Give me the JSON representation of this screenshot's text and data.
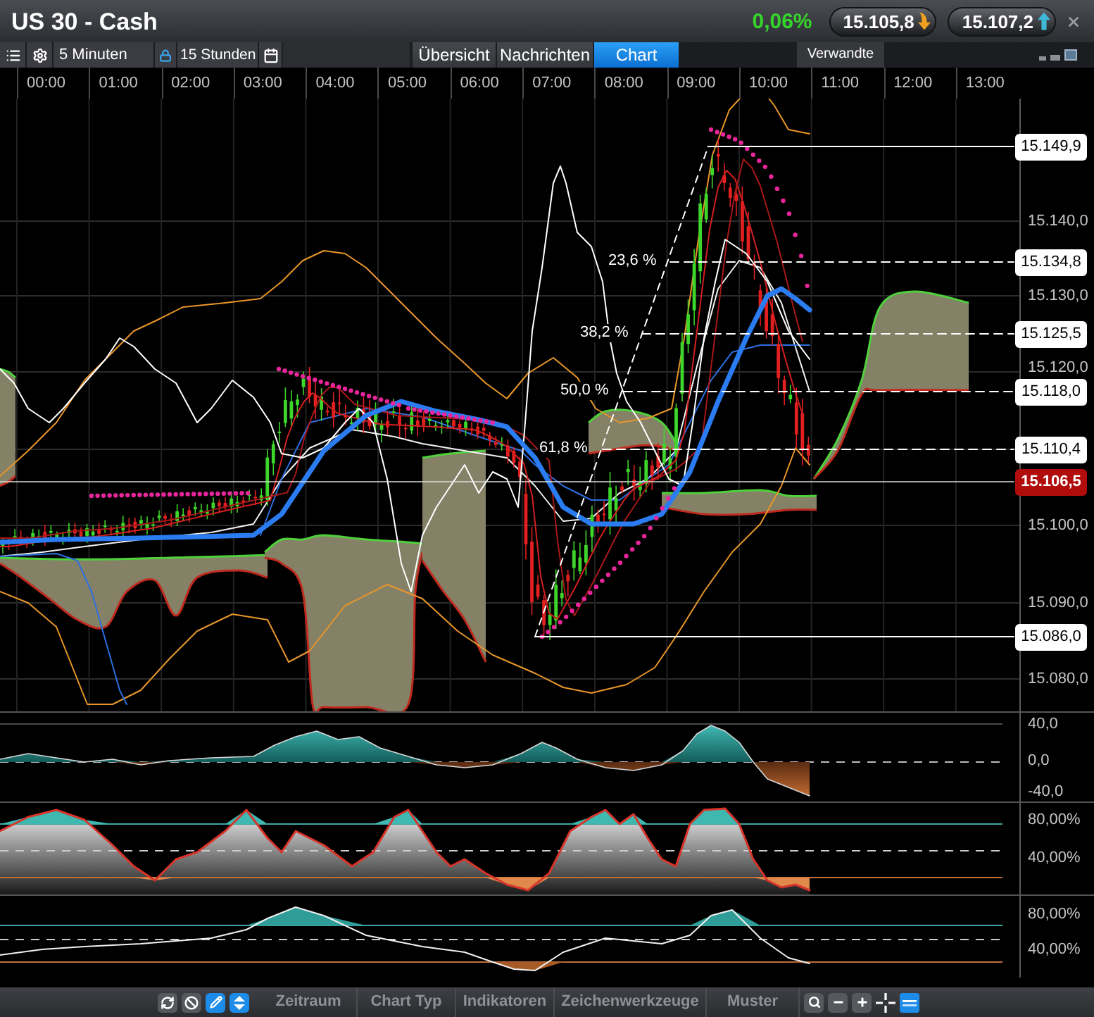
{
  "window": {
    "title": "US 30 - Cash",
    "change": "0,06%",
    "quotes": [
      {
        "value": "15.105,8",
        "up": false
      },
      {
        "value": "15.107,2",
        "up": true
      }
    ]
  },
  "toolbar": {
    "interval": "5 Minuten",
    "range": "15 Stunden"
  },
  "tabs": [
    {
      "label": "Übersicht",
      "selected": false
    },
    {
      "label": "Nachrichten",
      "selected": false
    },
    {
      "label": "Chart",
      "selected": true
    }
  ],
  "related_tab": "Verwandte",
  "time_axis": [
    "00:00",
    "01:00",
    "02:00",
    "03:00",
    "04:00",
    "05:00",
    "06:00",
    "07:00",
    "08:00",
    "09:00",
    "10:00",
    "11:00",
    "12:00",
    "13:00"
  ],
  "price_axis": [
    "15.140,0",
    "15.130,0",
    "15.120,0",
    "15.100,0",
    "15.090,0",
    "15.080,0"
  ],
  "price_markers": [
    {
      "label": "15.149,9",
      "kind": "level"
    },
    {
      "label": "15.134,8",
      "kind": "level"
    },
    {
      "label": "15.125,5",
      "kind": "level"
    },
    {
      "label": "15.118,0",
      "kind": "level"
    },
    {
      "label": "15.110,4",
      "kind": "level"
    },
    {
      "label": "15.106,5",
      "kind": "current"
    },
    {
      "label": "15.086,0",
      "kind": "level"
    }
  ],
  "fib_levels": [
    "23,6 %",
    "38,2 %",
    "50,0 %",
    "61,8 %"
  ],
  "panels": [
    {
      "axis": [
        "40,0",
        "0,0",
        "-40,0"
      ]
    },
    {
      "axis": [
        "80,00%",
        "40,00%"
      ]
    },
    {
      "axis": [
        "80,00%",
        "40,00%"
      ]
    }
  ],
  "bottom_menu": [
    "Zeitraum",
    "Chart Typ",
    "Indikatoren",
    "Zeichenwerkzeuge",
    "Muster"
  ]
}
